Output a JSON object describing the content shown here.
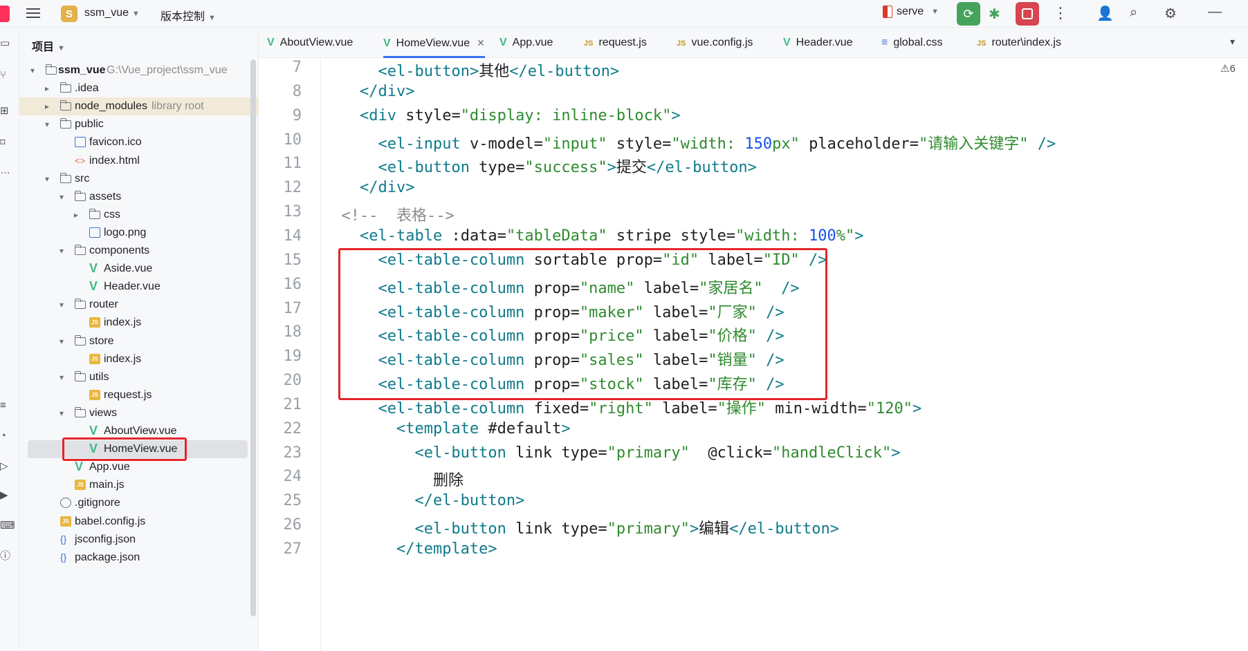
{
  "topbar": {
    "project_badge": "S",
    "project_name": "ssm_vue",
    "vcs_label": "版本控制",
    "run_config": "serve"
  },
  "project_panel": {
    "title": "项目",
    "root": {
      "name": "ssm_vue",
      "path": "G:\\Vue_project\\ssm_vue"
    },
    "tree": [
      {
        "label": ".idea",
        "hint": "",
        "icon": "folder-icon"
      },
      {
        "label": "node_modules",
        "hint": "library root",
        "icon": "folder-icon"
      },
      {
        "label": "public",
        "hint": "",
        "icon": "folder-icon"
      },
      {
        "label": "favicon.ico",
        "hint": "",
        "icon": "image-file-icon"
      },
      {
        "label": "index.html",
        "hint": "",
        "icon": "html-file-icon"
      },
      {
        "label": "src",
        "hint": "",
        "icon": "folder-icon"
      },
      {
        "label": "assets",
        "hint": "",
        "icon": "folder-icon"
      },
      {
        "label": "css",
        "hint": "",
        "icon": "folder-icon"
      },
      {
        "label": "logo.png",
        "hint": "",
        "icon": "image-file-icon"
      },
      {
        "label": "components",
        "hint": "",
        "icon": "folder-icon"
      },
      {
        "label": "Aside.vue",
        "hint": "",
        "icon": "vue-file-icon"
      },
      {
        "label": "Header.vue",
        "hint": "",
        "icon": "vue-file-icon"
      },
      {
        "label": "router",
        "hint": "",
        "icon": "folder-icon"
      },
      {
        "label": "index.js",
        "hint": "",
        "icon": "js-file-icon"
      },
      {
        "label": "store",
        "hint": "",
        "icon": "folder-icon"
      },
      {
        "label": "index.js",
        "hint": "",
        "icon": "js-file-icon"
      },
      {
        "label": "utils",
        "hint": "",
        "icon": "folder-icon"
      },
      {
        "label": "request.js",
        "hint": "",
        "icon": "js-file-icon"
      },
      {
        "label": "views",
        "hint": "",
        "icon": "folder-icon"
      },
      {
        "label": "AboutView.vue",
        "hint": "",
        "icon": "vue-file-icon"
      },
      {
        "label": "HomeView.vue",
        "hint": "",
        "icon": "vue-file-icon"
      },
      {
        "label": "App.vue",
        "hint": "",
        "icon": "vue-file-icon"
      },
      {
        "label": "main.js",
        "hint": "",
        "icon": "js-file-icon"
      },
      {
        "label": ".gitignore",
        "hint": "",
        "icon": "ignore-file-icon"
      },
      {
        "label": "babel.config.js",
        "hint": "",
        "icon": "js-file-icon"
      },
      {
        "label": "jsconfig.json",
        "hint": "",
        "icon": "json-file-icon"
      },
      {
        "label": "package.json",
        "hint": "",
        "icon": "json-file-icon"
      }
    ]
  },
  "tabs": [
    {
      "label": "AboutView.vue",
      "icon": "vue-file-icon"
    },
    {
      "label": "HomeView.vue",
      "icon": "vue-file-icon",
      "active": true
    },
    {
      "label": "App.vue",
      "icon": "vue-file-icon"
    },
    {
      "label": "request.js",
      "icon": "js-file-icon"
    },
    {
      "label": "vue.config.js",
      "icon": "js-file-icon"
    },
    {
      "label": "Header.vue",
      "icon": "vue-file-icon"
    },
    {
      "label": "global.css",
      "icon": "css-file-icon"
    },
    {
      "label": "router\\index.js",
      "icon": "js-file-icon"
    }
  ],
  "editor": {
    "warning_count": "6",
    "lines": [
      {
        "n": "7",
        "t": "      <el-button>其他</el-button>"
      },
      {
        "n": "8",
        "t": "    </div>"
      },
      {
        "n": "9",
        "t": "    <div style=\"display: inline-block\">"
      },
      {
        "n": "10",
        "t": "      <el-input v-model=\"input\" style=\"width: 150px\" placeholder=\"请输入关键字\" />"
      },
      {
        "n": "11",
        "t": "      <el-button type=\"success\">提交</el-button>"
      },
      {
        "n": "12",
        "t": "    </div>"
      },
      {
        "n": "13",
        "t": "  <!--  表格-->"
      },
      {
        "n": "14",
        "t": "    <el-table :data=\"tableData\" stripe style=\"width: 100%\">"
      },
      {
        "n": "15",
        "t": "      <el-table-column sortable prop=\"id\" label=\"ID\" />"
      },
      {
        "n": "16",
        "t": "      <el-table-column prop=\"name\" label=\"家居名\"  />"
      },
      {
        "n": "17",
        "t": "      <el-table-column prop=\"maker\" label=\"厂家\" />"
      },
      {
        "n": "18",
        "t": "      <el-table-column prop=\"price\" label=\"价格\" />"
      },
      {
        "n": "19",
        "t": "      <el-table-column prop=\"sales\" label=\"销量\" />"
      },
      {
        "n": "20",
        "t": "      <el-table-column prop=\"stock\" label=\"库存\" />"
      },
      {
        "n": "21",
        "t": "      <el-table-column fixed=\"right\" label=\"操作\" min-width=\"120\">"
      },
      {
        "n": "22",
        "t": "        <template #default>"
      },
      {
        "n": "23",
        "t": "          <el-button link type=\"primary\"  @click=\"handleClick\">"
      },
      {
        "n": "24",
        "t": "            删除"
      },
      {
        "n": "25",
        "t": "          </el-button>"
      },
      {
        "n": "26",
        "t": "          <el-button link type=\"primary\">编辑</el-button>"
      },
      {
        "n": "27",
        "t": "        </template>"
      }
    ]
  }
}
